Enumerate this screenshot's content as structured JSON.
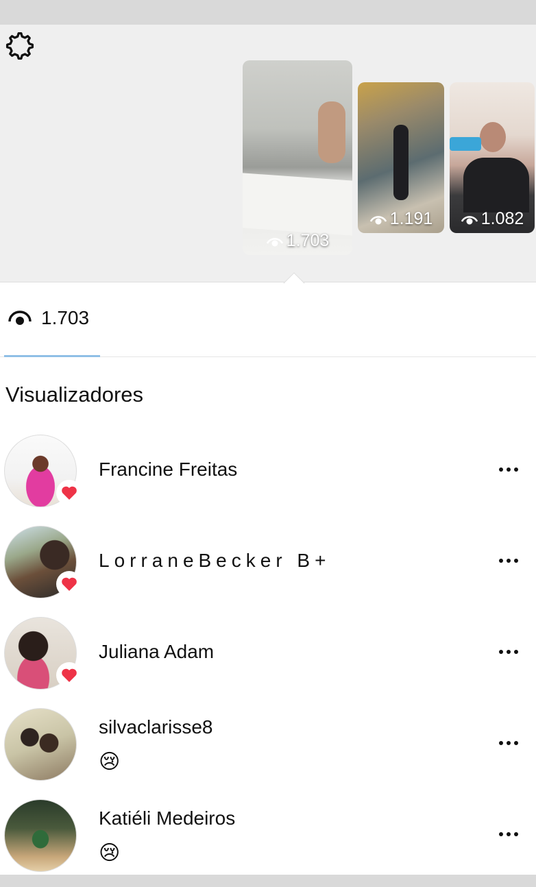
{
  "header": {
    "settings_icon": "gear-icon"
  },
  "stories": [
    {
      "views": "1.703",
      "selected": true
    },
    {
      "views": "1.191",
      "selected": false
    },
    {
      "views": "1.082",
      "selected": false
    }
  ],
  "summary": {
    "views_icon": "eye-icon",
    "views_count": "1.703"
  },
  "section": {
    "title": "Visualizadores"
  },
  "viewers": [
    {
      "name": "Francine Freitas",
      "liked": true,
      "reaction": ""
    },
    {
      "name": "LorraneBecker B+",
      "liked": true,
      "reaction": ""
    },
    {
      "name": "Juliana Adam",
      "liked": true,
      "reaction": ""
    },
    {
      "name": "silvaclarisse8",
      "liked": false,
      "reaction": "😢"
    },
    {
      "name": "Katiéli Medeiros",
      "liked": false,
      "reaction": "😢"
    }
  ],
  "colors": {
    "heart": "#ee3347",
    "tab_indicator": "#8fbfe6",
    "top_band": "#efefef"
  }
}
